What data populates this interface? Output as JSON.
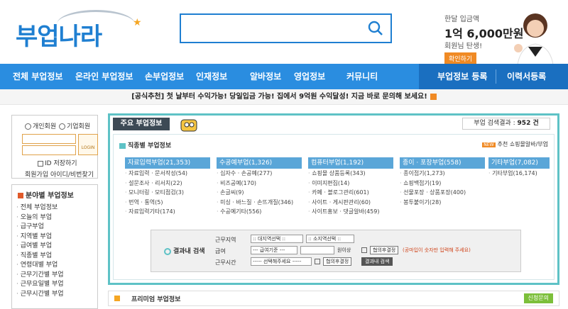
{
  "header": {
    "logo": "부업나라",
    "search": {
      "placeholder": ""
    },
    "promo": {
      "line1": "한달 입금액",
      "line2": "1억 6,000만원",
      "line3": "회원님 탄생!",
      "button": "확인하기"
    }
  },
  "nav": {
    "items": [
      "전체 부업정보",
      "온라인 부업정보",
      "손부업정보",
      "인재정보",
      "알바정보",
      "영업정보",
      "커뮤니티"
    ],
    "right": [
      "부업정보 등록",
      "이력서등록"
    ]
  },
  "notice": {
    "text": "[공식추천] 첫 날부터 수익가능! 당일입금 가능! 집에서 9억원 수익달성! 지금 바로 문의해 보세요!"
  },
  "login": {
    "radio_personal": "개인회원",
    "radio_company": "기업회원",
    "login_button": "LOGIN",
    "save_id": "ID 저장하기",
    "links": "회원가입 아이디/비번찾기"
  },
  "sidebar": {
    "title": "분야별 부업정보",
    "items": [
      "전체 부업정보",
      "오늘의 부업",
      "급구부업",
      "지역별 부업",
      "급여별 부업",
      "직종별 부업",
      "연령대별 부업",
      "근무기간별 부업",
      "근무요일별 부업",
      "근무시간별 부업"
    ]
  },
  "main": {
    "tab": "주요 부업정보",
    "count_label": "부업 검색결과 :",
    "count_value": "952 건",
    "section_title": "직종별 부업정보",
    "recommend_badge": "NEW",
    "recommend_link": "추천 쇼핑몰알바/부업",
    "columns": [
      {
        "head": "자료입력부업(21,353)",
        "items": [
          "자료입력 · 문서작성(54)",
          "설문조사 · 리서치(22)",
          "모니터링 · 모티점검(3)",
          "번역 · 통역(5)",
          "자료입력기타(174)"
        ]
      },
      {
        "head": "수공예부업(1,326)",
        "items": [
          "십자수 · 손공예(277)",
          "비즈공예(170)",
          "손글씨(9)",
          "미싱 · 바느질 · 손뜨개질(346)",
          "수공예기타(556)"
        ]
      },
      {
        "head": "컴퓨터부업(1,192)",
        "items": [
          "쇼핑몰 상품등록(343)",
          "이미지편집(14)",
          "카페 · 블로그관리(601)",
          "사이트 · 게시판관리(60)",
          "사이트홍보 · 댓글알바(459)"
        ]
      },
      {
        "head": "종이 · 포장부업(558)",
        "items": [
          "종이접기(1,273)",
          "쇼핑백접기(19)",
          "선물포장 · 상품포장(400)",
          "봉투붙이기(28)"
        ]
      },
      {
        "head": "기타부업(7,082)",
        "items": [
          "기타부업(16,174)"
        ]
      }
    ],
    "filter": {
      "label": "결과내 검색",
      "row1_label": "근무지역",
      "row1_sel1": ":: 대지역선택 ::",
      "row1_sel2": ":: 소지역선택 ::",
      "row2_label": "급여",
      "row2_sel1": "--- 급여기준 ---",
      "row2_unit": "원이상",
      "row2_btn": "협의후결정",
      "row2_hint": "(공마입이 숫자만 입력해 주세요)",
      "row3_label": "근무시간",
      "row3_sel1": "----- 선택해주세요 -----",
      "row3_btn": "협의후결정",
      "row3_submit": "결과내 검색"
    }
  },
  "premium": {
    "title": "프리미엄 부업정보",
    "button": "신청문의"
  }
}
